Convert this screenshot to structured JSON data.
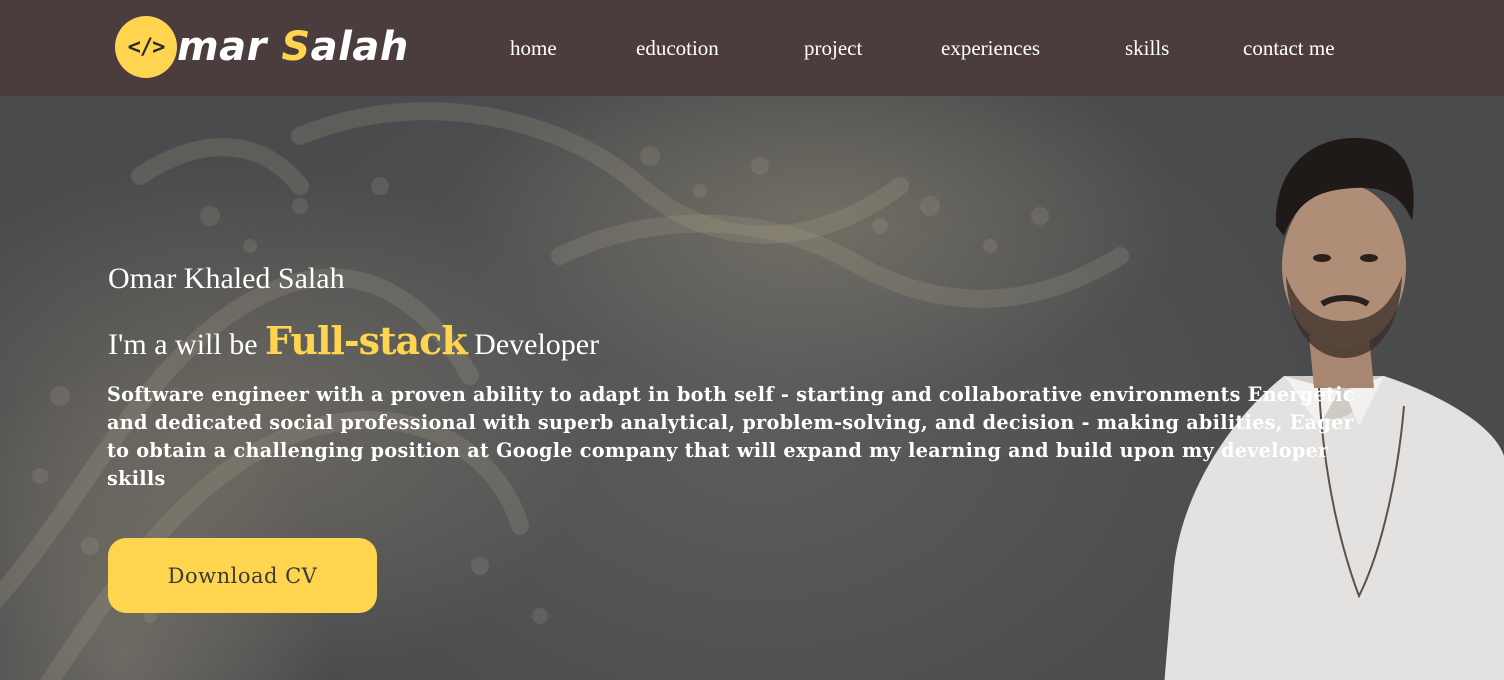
{
  "logo": {
    "badge_glyph": "</>",
    "text_lead": "mar ",
    "text_highlight": "S",
    "text_tail": "alah"
  },
  "nav": {
    "items": [
      {
        "label": "home"
      },
      {
        "label": "educotion"
      },
      {
        "label": "project"
      },
      {
        "label": "experiences"
      },
      {
        "label": "skills"
      },
      {
        "label": "contact me"
      }
    ]
  },
  "hero": {
    "name": "Omar Khaled Salah",
    "role_prefix": "I'm a will be ",
    "role_highlight": "Full-stack",
    "role_suffix": " Developer",
    "bio": "Software engineer with a proven ability to adapt in both self - starting and collaborative environments Energetic and dedicated social professional with superb analytical, problem-solving, and decision - making abilities, Eager to obtain a challenging position at Google company that will expand my learning and build upon my developer skills",
    "cta_label": "Download CV"
  },
  "colors": {
    "navbar_bg": "#4b3d3e",
    "accent_yellow": "#ffd54f",
    "hero_bg": "#4e4e50",
    "text": "#ffffff"
  },
  "icons": {
    "logo_badge": "code-icon"
  }
}
